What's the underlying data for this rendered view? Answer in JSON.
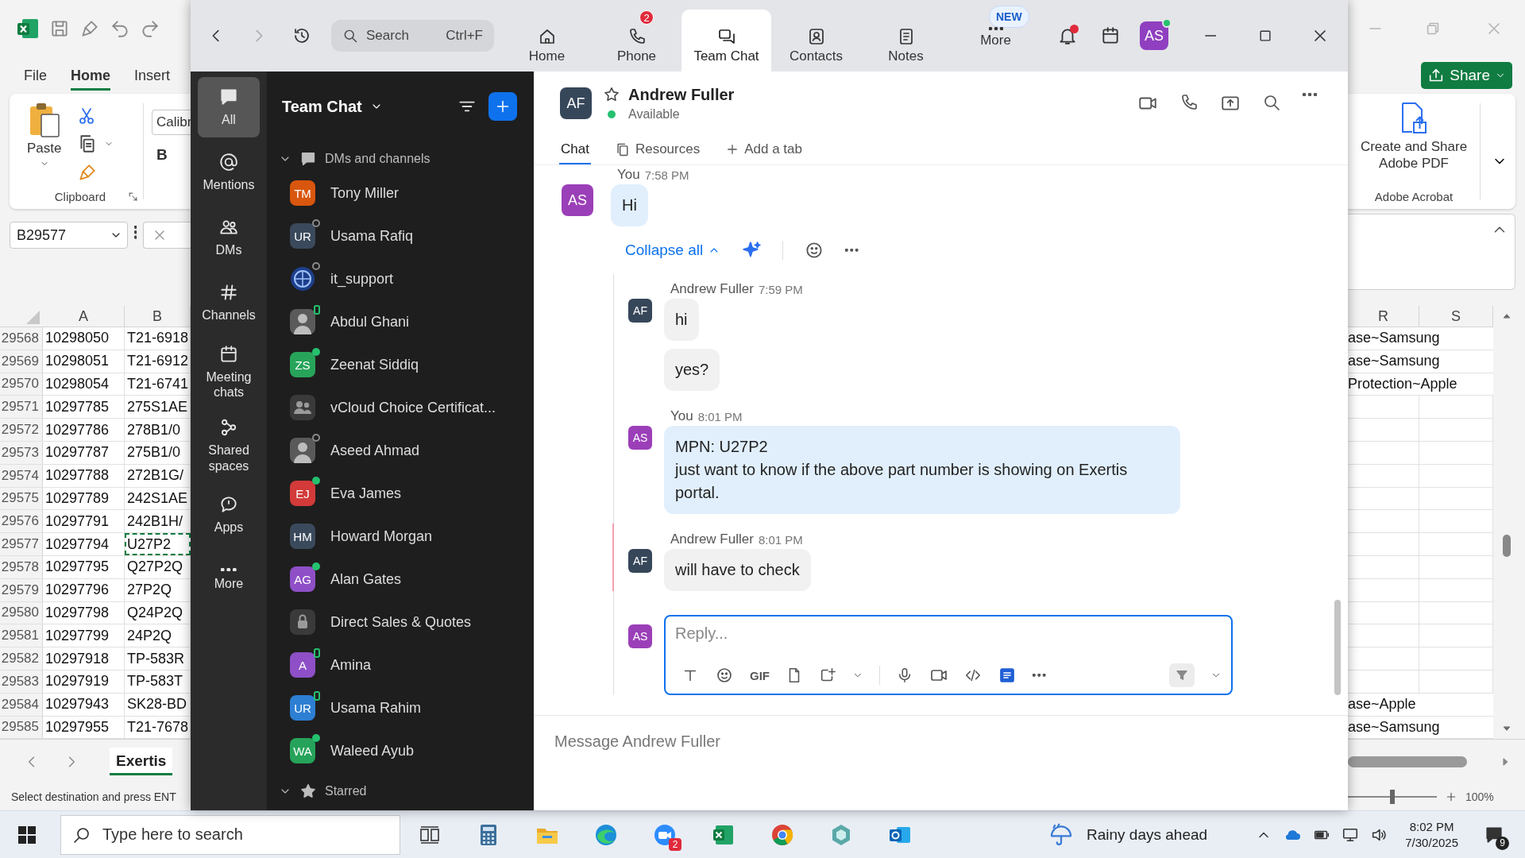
{
  "excel": {
    "menu": [
      {
        "label": "File",
        "selected": false
      },
      {
        "label": "Home",
        "selected": true
      },
      {
        "label": "Insert",
        "selected": false
      }
    ],
    "paste": "Paste",
    "clipboard_group": "Clipboard",
    "font_name": "Calibr",
    "bold": "B",
    "name_box": "B29577",
    "columns_left": [
      "A",
      "B"
    ],
    "rows": [
      {
        "num": "29568",
        "a": "10298050",
        "b": "T21-6918",
        "r": "ase~Samsung",
        "selected": false
      },
      {
        "num": "29569",
        "a": "10298051",
        "b": "T21-6912",
        "r": "ase~Samsung",
        "selected": false
      },
      {
        "num": "29570",
        "a": "10298054",
        "b": "T21-6741",
        "r": "Protection~Apple",
        "selected": false
      },
      {
        "num": "29571",
        "a": "10297785",
        "b": "275S1AE",
        "selected": false
      },
      {
        "num": "29572",
        "a": "10297786",
        "b": "278B1/0",
        "selected": false
      },
      {
        "num": "29573",
        "a": "10297787",
        "b": "275B1/0",
        "selected": false
      },
      {
        "num": "29574",
        "a": "10297788",
        "b": "272B1G/",
        "selected": false
      },
      {
        "num": "29575",
        "a": "10297789",
        "b": "242S1AE",
        "selected": false
      },
      {
        "num": "29576",
        "a": "10297791",
        "b": "242B1H/",
        "selected": false
      },
      {
        "num": "29577",
        "a": "10297794",
        "b": "U27P2",
        "selected": true
      },
      {
        "num": "29578",
        "a": "10297795",
        "b": "Q27P2Q",
        "selected": false
      },
      {
        "num": "29579",
        "a": "10297796",
        "b": "27P2Q",
        "selected": false
      },
      {
        "num": "29580",
        "a": "10297798",
        "b": "Q24P2Q",
        "selected": false
      },
      {
        "num": "29581",
        "a": "10297799",
        "b": "24P2Q",
        "selected": false
      },
      {
        "num": "29582",
        "a": "10297918",
        "b": "TP-583R",
        "selected": false
      },
      {
        "num": "29583",
        "a": "10297919",
        "b": "TP-583T",
        "selected": false
      },
      {
        "num": "29584",
        "a": "10297943",
        "b": "SK28-BD",
        "r": "ase~Apple",
        "selected": false
      },
      {
        "num": "29585",
        "a": "10297955",
        "b": "T21-7678",
        "r": "ase~Samsung",
        "selected": false
      }
    ],
    "sheet_tab": "Exertis",
    "status": "Select destination and press ENT",
    "share": "Share",
    "pdf_button": "Create and Share Adobe PDF",
    "acrobat_group": "Adobe Acrobat",
    "columns_right": [
      "R",
      "S"
    ],
    "zoom_slider": {
      "level": 0.5
    },
    "zoom_level": "100%"
  },
  "zoom": {
    "search": {
      "placeholder": "Search",
      "shortcut": "Ctrl+F"
    },
    "tabs": [
      {
        "label": "Home",
        "selected": false
      },
      {
        "label": "Phone",
        "badge": "2",
        "selected": false
      },
      {
        "label": "Team Chat",
        "selected": true
      },
      {
        "label": "Contacts",
        "selected": false
      },
      {
        "label": "Notes",
        "selected": false
      },
      {
        "label": "More",
        "tag": "NEW",
        "selected": false
      }
    ],
    "bell": {
      "unread": true
    },
    "profile": {
      "initials": "AS",
      "online": true
    },
    "rail": [
      {
        "label": "All",
        "selected": true
      },
      {
        "label": "Mentions",
        "selected": false
      },
      {
        "label": "DMs",
        "selected": false
      },
      {
        "label": "Channels",
        "selected": false
      },
      {
        "label": "Meeting chats",
        "selected": false
      },
      {
        "label": "Shared spaces",
        "selected": false
      },
      {
        "label": "Apps",
        "selected": false
      },
      {
        "label": "More",
        "selected": false
      }
    ],
    "list": {
      "title": "Team Chat",
      "sections": [
        {
          "label": "DMs and channels",
          "expanded": true,
          "items": [
            {
              "name": "Tony Miller",
              "avatar": {
                "kind": "initials",
                "text": "TM",
                "color": "#d9560f"
              }
            },
            {
              "name": "Usama Rafiq",
              "avatar": {
                "kind": "initials",
                "text": "UR",
                "color": "#3a4a5c"
              },
              "presence": {
                "kind": "ring",
                "color": "#8a8a8a"
              }
            },
            {
              "name": "it_support",
              "avatar": {
                "kind": "logo"
              },
              "presence": {
                "kind": "ring",
                "color": "#8a8a8a"
              }
            },
            {
              "name": "Abdul Ghani",
              "avatar": {
                "kind": "photo"
              },
              "presence": {
                "kind": "phone",
                "color": "#25c16f"
              }
            },
            {
              "name": "Zeenat Siddiq",
              "avatar": {
                "kind": "initials",
                "text": "ZS",
                "color": "#27a45a"
              },
              "presence": {
                "kind": "dot",
                "color": "#25c16f"
              }
            },
            {
              "name": "vCloud Choice Certificat...",
              "avatar": {
                "kind": "group"
              }
            },
            {
              "name": "Aseed Ahmad",
              "avatar": {
                "kind": "photo"
              },
              "presence": {
                "kind": "ring",
                "color": "#8a8a8a"
              }
            },
            {
              "name": "Eva James",
              "avatar": {
                "kind": "initials",
                "text": "EJ",
                "color": "#d33a3a"
              },
              "presence": {
                "kind": "dot",
                "color": "#25c16f"
              }
            },
            {
              "name": "Howard Morgan",
              "avatar": {
                "kind": "initials",
                "text": "HM",
                "color": "#3a4a5c"
              }
            },
            {
              "name": "Alan Gates",
              "avatar": {
                "kind": "initials",
                "text": "AG",
                "color": "#8e4fc7"
              },
              "presence": {
                "kind": "dot",
                "color": "#25c16f"
              }
            },
            {
              "name": "Direct Sales & Quotes",
              "avatar": {
                "kind": "lock"
              }
            },
            {
              "name": "Amina",
              "avatar": {
                "kind": "initials",
                "text": "A",
                "color": "#8e4fc7"
              },
              "presence": {
                "kind": "phone",
                "color": "#25c16f"
              }
            },
            {
              "name": "Usama Rahim",
              "avatar": {
                "kind": "initials",
                "text": "UR",
                "color": "#2d7fd3"
              },
              "presence": {
                "kind": "phone",
                "color": "#25c16f"
              }
            },
            {
              "name": "Waleed Ayub",
              "avatar": {
                "kind": "initials",
                "text": "WA",
                "color": "#26a35a"
              },
              "presence": {
                "kind": "dot",
                "color": "#25c16f"
              }
            }
          ]
        },
        {
          "label": "Starred",
          "expanded": true
        }
      ]
    },
    "chat": {
      "contact": {
        "initials": "AF",
        "name": "Andrew Fuller",
        "presence": "Available",
        "online": true,
        "favorite": false
      },
      "tabs": [
        {
          "label": "Chat",
          "selected": true
        },
        {
          "label": "Resources",
          "selected": false
        }
      ],
      "add_tab": "Add a tab",
      "messages": [
        {
          "sender": "You",
          "time": "7:58 PM",
          "initials": "AS",
          "color": "#9b3fb8",
          "mine": true,
          "bubbles": [
            "Hi"
          ]
        }
      ],
      "thread_toggle": "Collapse all",
      "replies": [
        {
          "sender": "Andrew Fuller",
          "time": "7:59 PM",
          "initials": "AF",
          "color": "#37475a",
          "mine": false,
          "unread": false,
          "bubbles": [
            "hi",
            "yes?"
          ]
        },
        {
          "sender": "You",
          "time": "8:01 PM",
          "initials": "AS",
          "color": "#9b3fb8",
          "mine": true,
          "unread": false,
          "bubbles": [
            "MPN: U27P2\njust want to know if the above part number is showing on Exertis portal."
          ]
        },
        {
          "sender": "Andrew Fuller",
          "time": "8:01 PM",
          "initials": "AF",
          "color": "#37475a",
          "mine": false,
          "unread": true,
          "bubbles": [
            "will have to check"
          ]
        }
      ],
      "reply_box": {
        "initials": "AS",
        "color": "#9b3fb8",
        "placeholder": "Reply...",
        "gif": "GIF"
      },
      "composer": {
        "placeholder": "Message Andrew Fuller"
      }
    }
  },
  "taskbar": {
    "search_placeholder": "Type here to search",
    "zoom_badge": "2",
    "weather": "Rainy days ahead",
    "time": "8:02 PM",
    "date": "7/30/2025",
    "notifications": "9"
  }
}
